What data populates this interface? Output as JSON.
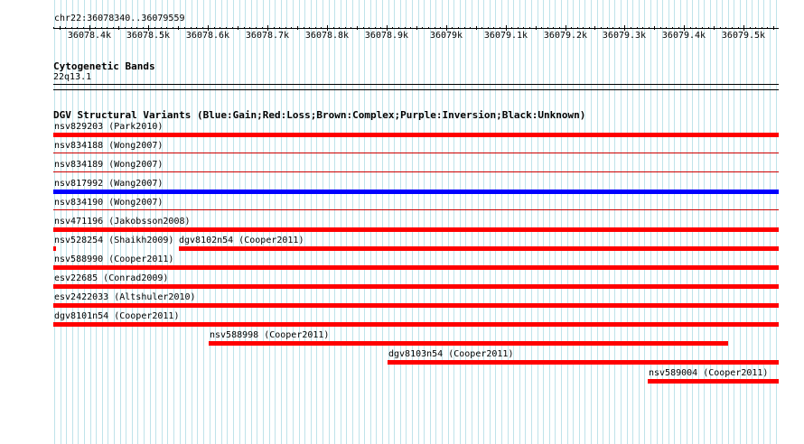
{
  "region": {
    "label": "chr22:36078340..36079559",
    "start": 36078340,
    "end": 36079559
  },
  "ruler": {
    "tick_labels": [
      "36078.4k",
      "36078.5k",
      "36078.6k",
      "36078.7k",
      "36078.8k",
      "36078.9k",
      "36079k",
      "36079.1k",
      "36079.2k",
      "36079.3k",
      "36079.4k",
      "36079.5k"
    ]
  },
  "tracks": {
    "cytoband": {
      "title": "Cytogenetic Bands",
      "band": "22q13.1"
    },
    "dgv": {
      "title": "DGV Structural Variants (Blue:Gain;Red:Loss;Brown:Complex;Purple:Inversion;Black:Unknown)",
      "colors": {
        "gain": "#0000ff",
        "loss": "#ff0000",
        "separator": "#cc0000"
      },
      "features": [
        {
          "label": "nsv829203 (Park2010)",
          "type": "loss",
          "start": 36078340,
          "end": 36079559
        },
        {
          "label": "nsv834188 (Wong2007)",
          "type": "loss",
          "start": 36078340,
          "end": 36079559
        },
        {
          "label": "nsv834189 (Wong2007)",
          "type": "loss",
          "start": 36078340,
          "end": 36079559
        },
        {
          "label": "nsv817992 (Wang2007)",
          "type": "gain",
          "start": 36078340,
          "end": 36079559
        },
        {
          "label": "nsv834190 (Wong2007)",
          "type": "loss",
          "start": 36078340,
          "end": 36079559
        },
        {
          "label": "nsv471196 (Jakobsson2008)",
          "type": "loss",
          "start": 36078340,
          "end": 36079559
        },
        {
          "label": "nsv528254 (Shaikh2009)",
          "type": "loss",
          "start": 36078340,
          "end": 36078344
        },
        {
          "label": "dgv8102n54 (Cooper2011)",
          "type": "loss",
          "start": 36078551,
          "end": 36079559
        },
        {
          "label": "nsv588990 (Cooper2011)",
          "type": "loss",
          "start": 36078340,
          "end": 36079559
        },
        {
          "label": "esv22685 (Conrad2009)",
          "type": "loss",
          "start": 36078340,
          "end": 36079559
        },
        {
          "label": "esv2422033 (Altshuler2010)",
          "type": "loss",
          "start": 36078340,
          "end": 36079559
        },
        {
          "label": "dgv8101n54 (Cooper2011)",
          "type": "loss",
          "start": 36078340,
          "end": 36079559
        },
        {
          "label": "nsv588998 (Cooper2011)",
          "type": "loss",
          "start": 36078601,
          "end": 36079474
        },
        {
          "label": "dgv8103n54 (Cooper2011)",
          "type": "loss",
          "start": 36078901,
          "end": 36079559
        },
        {
          "label": "nsv589004 (Cooper2011)",
          "type": "loss",
          "start": 36079339,
          "end": 36079559
        }
      ]
    }
  }
}
